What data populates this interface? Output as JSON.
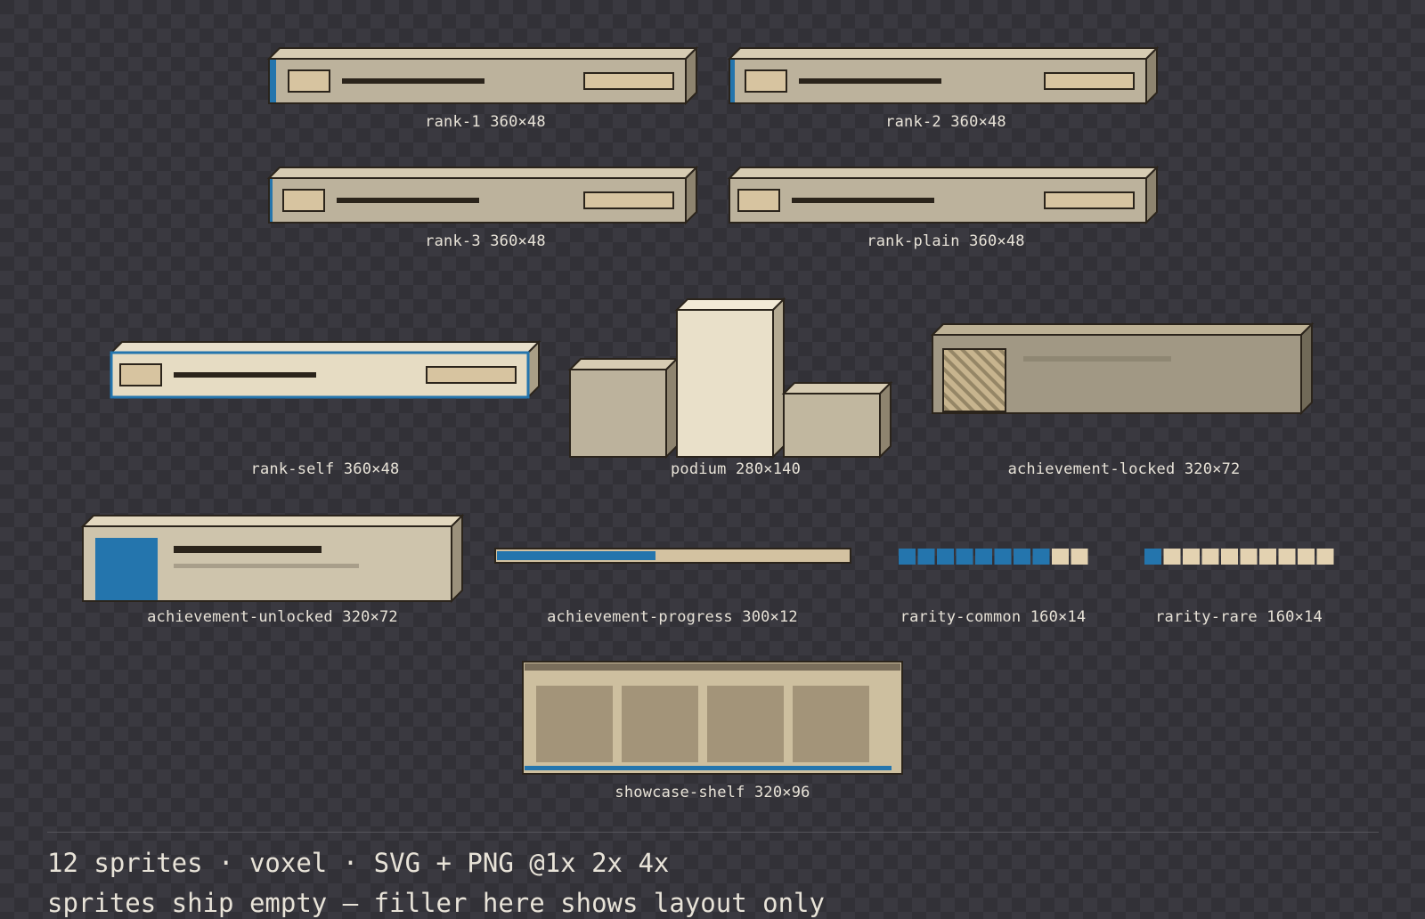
{
  "sprites": {
    "rank_1": {
      "name": "rank-1",
      "size": "360×48"
    },
    "rank_2": {
      "name": "rank-2",
      "size": "360×48"
    },
    "rank_3": {
      "name": "rank-3",
      "size": "360×48"
    },
    "rank_plain": {
      "name": "rank-plain",
      "size": "360×48"
    },
    "rank_self": {
      "name": "rank-self",
      "size": "360×48"
    },
    "podium": {
      "name": "podium",
      "size": "280×140"
    },
    "achievement_locked": {
      "name": "achievement-locked",
      "size": "320×72"
    },
    "achievement_unlocked": {
      "name": "achievement-unlocked",
      "size": "320×72"
    },
    "achievement_progress": {
      "name": "achievement-progress",
      "size": "300×12",
      "progress": 0.45
    },
    "rarity_common": {
      "name": "rarity-common",
      "size": "160×14",
      "filled": 8,
      "total": 10
    },
    "rarity_rare": {
      "name": "rarity-rare",
      "size": "160×14",
      "filled": 1,
      "total": 10
    },
    "showcase_shelf": {
      "name": "showcase-shelf",
      "size": "320×96",
      "slots": 4
    }
  },
  "labels": {
    "rank_1": "rank-1 360×48",
    "rank_2": "rank-2 360×48",
    "rank_3": "rank-3 360×48",
    "rank_plain": "rank-plain 360×48",
    "rank_self": "rank-self 360×48",
    "podium": "podium 280×140",
    "achievement_locked": "achievement-locked 320×72",
    "achievement_unlocked": "achievement-unlocked 320×72",
    "achievement_progress": "achievement-progress 300×12",
    "rarity_common": "rarity-common 160×14",
    "rarity_rare": "rarity-rare 160×14",
    "showcase_shelf": "showcase-shelf 320×96"
  },
  "footer": {
    "line1": "12 sprites · voxel · SVG + PNG @1x 2x 4x",
    "line2": "sprites ship empty — filler here shows layout only"
  },
  "colors": {
    "background": "#323137",
    "checker": "#3a3940",
    "panel_face": "#bcb29c",
    "panel_top": "#d7ccb3",
    "panel_side": "#8e846f",
    "outline": "#2b241b",
    "accent_blue": "#2475ad",
    "cream": "#e6dcc3",
    "text": "#e8e3d8"
  }
}
